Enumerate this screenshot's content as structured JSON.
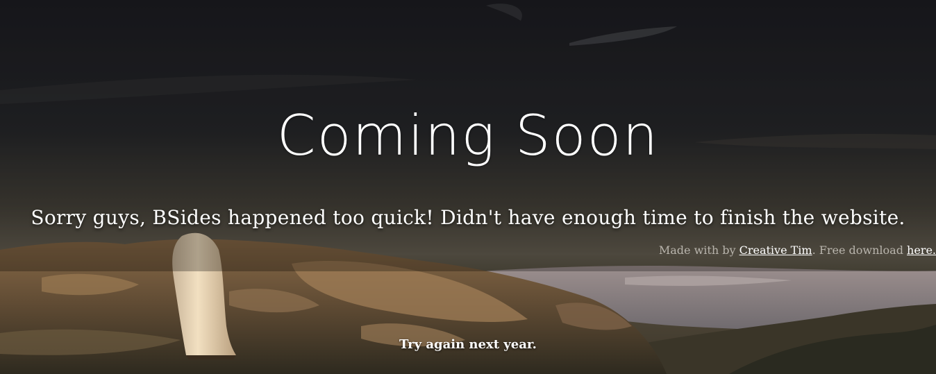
{
  "hero": {
    "title": "Coming Soon",
    "subtitle": "Sorry guys, BSides happened too quick! Didn't have enough time to finish the website."
  },
  "credits": {
    "prefix": "Made with by ",
    "author_link": "Creative Tim",
    "middle": ". Free download ",
    "download_link": "here."
  },
  "footer": {
    "text": "Try again next year."
  },
  "colors": {
    "sky": "#232226",
    "horizon": "#5a554a",
    "rock": "#7a5a3a",
    "overlay": "#000000",
    "text": "#ffffff",
    "credits_text": "#b9b5ad"
  }
}
